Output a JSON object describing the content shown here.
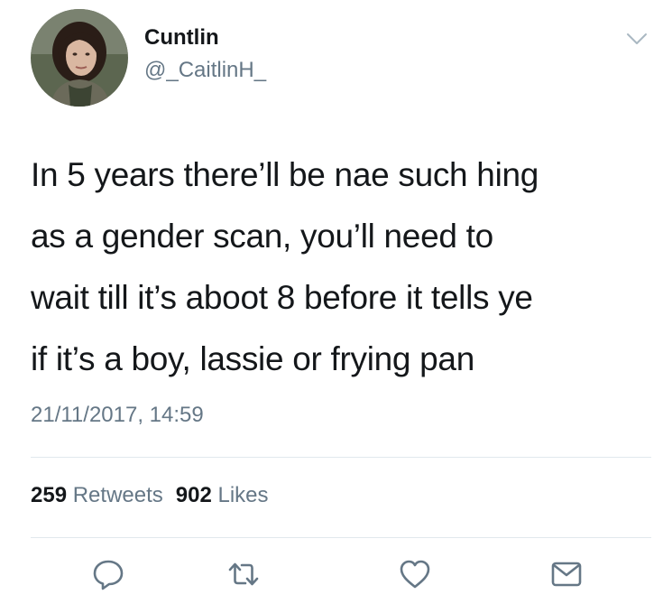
{
  "user": {
    "display_name": "Cuntlin",
    "handle": "@_CaitlinH_"
  },
  "tweet": {
    "lines": [
      "In 5 years there’ll be nae such hing",
      "as a gender scan, you’ll need to",
      "wait till it’s aboot 8 before it tells ye",
      "if it’s a boy, lassie or frying pan"
    ],
    "timestamp": "21/11/2017, 14:59"
  },
  "stats": {
    "retweets_count": "259",
    "retweets_label": "Retweets",
    "likes_count": "902",
    "likes_label": "Likes"
  },
  "actions": [
    {
      "name": "reply-icon"
    },
    {
      "name": "retweet-icon"
    },
    {
      "name": "like-icon"
    },
    {
      "name": "direct-message-icon"
    }
  ],
  "colors": {
    "text": "#14171a",
    "secondary": "#657786",
    "divider": "#e1e8ed",
    "icon": "#657786"
  }
}
